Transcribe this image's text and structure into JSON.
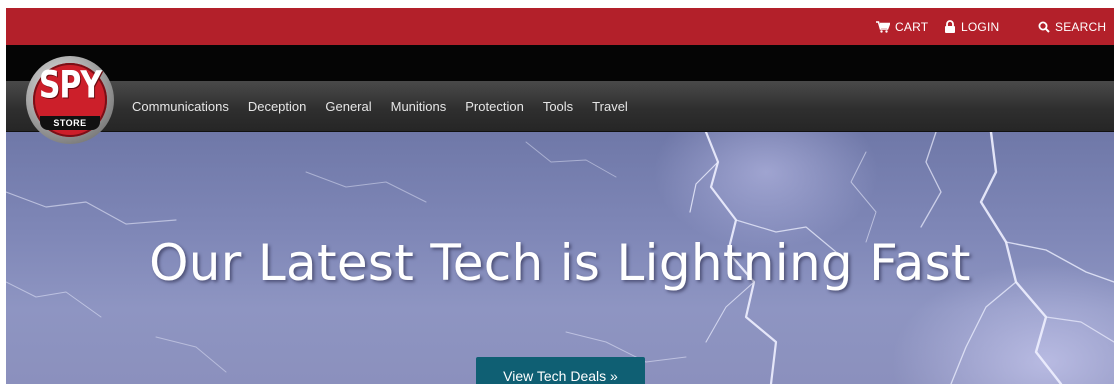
{
  "topbar": {
    "cart_label": "CART",
    "login_label": "LOGIN",
    "search_label": "SEARCH",
    "background_color": "#b3202a"
  },
  "logo": {
    "top_text": "SPY",
    "bottom_text": "STORE"
  },
  "nav": {
    "items": [
      {
        "label": "Communications"
      },
      {
        "label": "Deception"
      },
      {
        "label": "General"
      },
      {
        "label": "Munitions"
      },
      {
        "label": "Protection"
      },
      {
        "label": "Tools"
      },
      {
        "label": "Travel"
      }
    ]
  },
  "hero": {
    "headline": "Our Latest Tech is Lightning Fast",
    "cta_label": "View Tech Deals »",
    "cta_color": "#0f5f73"
  }
}
